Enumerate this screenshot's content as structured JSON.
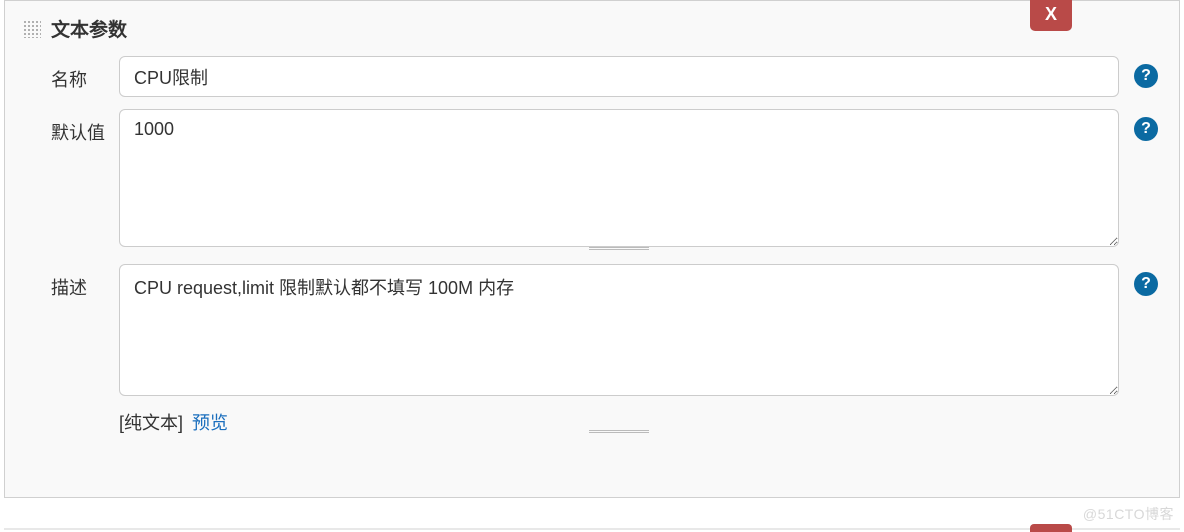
{
  "panel": {
    "title": "文本参数",
    "close_label": "X"
  },
  "fields": {
    "name": {
      "label": "名称",
      "value": "CPU限制"
    },
    "default_value": {
      "label": "默认值",
      "value": "1000"
    },
    "description": {
      "label": "描述",
      "value": "CPU request,limit 限制默认都不填写 100M 内存",
      "format_prefix": "[",
      "format_label": "纯文本",
      "format_suffix": "]",
      "preview_label": "预览"
    }
  },
  "help": {
    "icon_text": "?"
  },
  "watermark": "@51CTO博客"
}
